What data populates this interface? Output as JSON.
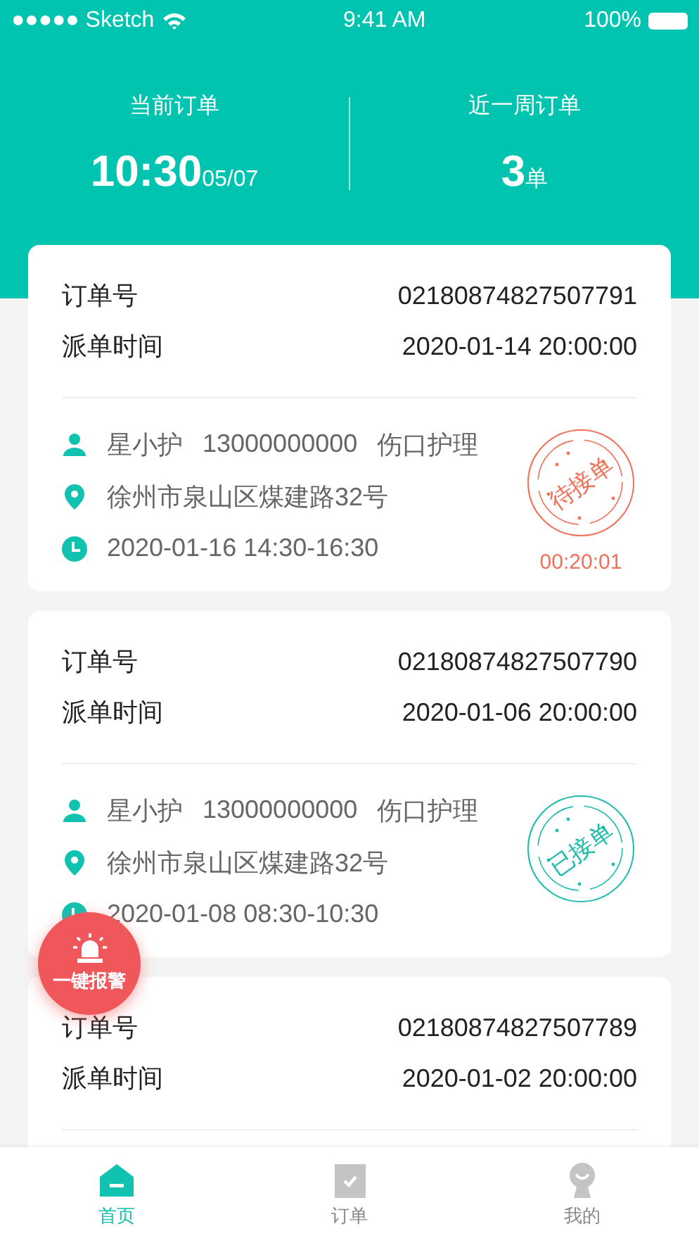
{
  "status_bar": {
    "carrier": "●●●●● Sketch",
    "time": "9:41 AM",
    "battery": "100%"
  },
  "summary": [
    {
      "label": "当前订单",
      "value": "10:30",
      "suffix": "05/07"
    },
    {
      "label": "近一周订单",
      "value": "3",
      "suffix": "单"
    }
  ],
  "orders": [
    {
      "kind": "full",
      "order_label": "订单号",
      "order_no": "02180874827507791",
      "time_label": "派单时间",
      "dispatch_time": "2020-01-14 20:00:00",
      "patient": "星小护",
      "phone": "13000000000",
      "service": "伤口护理",
      "address": "徐州市泉山区煤建路32号",
      "appointment": "2020-01-16 14:30-16:30",
      "stamp": {
        "kind": "pending",
        "label": "待接单"
      },
      "countdown": "00:20:01"
    },
    {
      "kind": "full",
      "order_label": "订单号",
      "order_no": "02180874827507790",
      "time_label": "派单时间",
      "dispatch_time": "2020-01-06 20:00:00",
      "patient": "星小护",
      "phone": "13000000000",
      "service": "伤口护理",
      "address": "徐州市泉山区煤建路32号",
      "appointment": "2020-01-08 08:30-10:30",
      "stamp": {
        "kind": "accepted",
        "label": "已接单"
      }
    },
    {
      "kind": "partial",
      "order_label": "订单号",
      "order_no": "02180874827507789",
      "time_label": "派单时间",
      "dispatch_time": "2020-01-02 20:00:00"
    }
  ],
  "alarm_button": {
    "label": "一键报警"
  },
  "tabs": [
    {
      "label": "首页",
      "kind": "home",
      "selected": true
    },
    {
      "label": "订单",
      "kind": "check",
      "selected": false
    },
    {
      "label": "我的",
      "kind": "person",
      "selected": false
    }
  ]
}
